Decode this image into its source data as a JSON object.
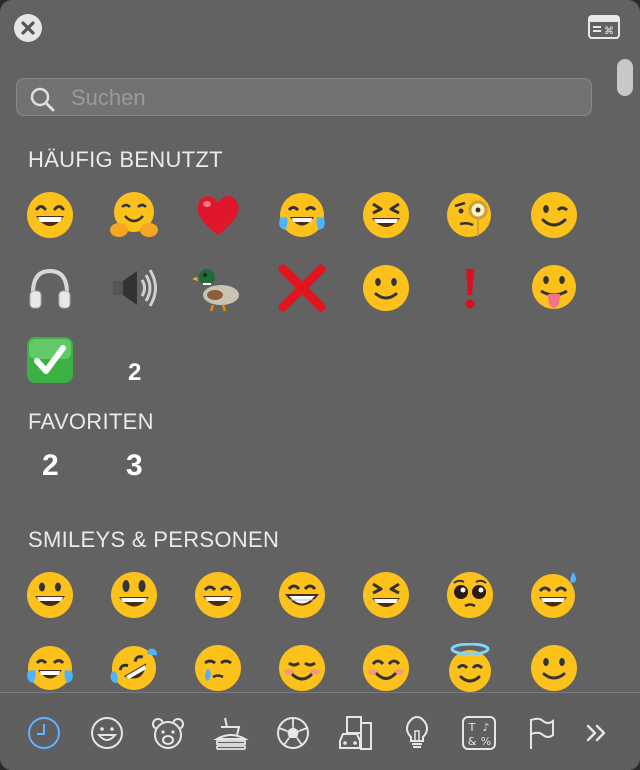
{
  "header": {
    "close_icon": "close-icon",
    "keyboard_viewer_icon": "keyboard-viewer-icon"
  },
  "search": {
    "placeholder": "Suchen",
    "value": "",
    "icon": "search-icon"
  },
  "sections": {
    "frequent": {
      "title": "HÄUFIG BENUTZT",
      "items": [
        "grinning-squinting-face",
        "hugging-face",
        "red-heart",
        "face-with-tears-of-joy",
        "grinning-squinting-eyes-face",
        "face-with-monocle",
        "winking-face",
        "headphones",
        "speaker-high-volume",
        "duck",
        "cross-mark",
        "slightly-smiling-face",
        "exclamation-mark",
        "face-with-tongue",
        "check-mark-button"
      ],
      "extra_number": "2"
    },
    "favorites": {
      "title": "FAVORITEN",
      "numbers": [
        "2",
        "3"
      ]
    },
    "smileys": {
      "title": "SMILEYS & PERSONEN",
      "items": [
        "grinning-face",
        "grinning-face-big-eyes",
        "grinning-face-smiling-eyes",
        "beaming-face",
        "grinning-squinting-face",
        "pleading-face",
        "grinning-face-with-sweat",
        "face-with-tears-of-joy",
        "rolling-on-floor-laughing",
        "face-holding-back-tears",
        "smiling-face",
        "smiling-face-with-smiling-eyes",
        "smiling-face-with-halo",
        "slightly-smiling-face"
      ]
    }
  },
  "categories": [
    {
      "name": "recent",
      "icon": "clock-icon",
      "selected": true
    },
    {
      "name": "smileys",
      "icon": "smiley-icon"
    },
    {
      "name": "animals",
      "icon": "bear-icon"
    },
    {
      "name": "food",
      "icon": "burger-drink-icon"
    },
    {
      "name": "activity",
      "icon": "soccer-ball-icon"
    },
    {
      "name": "travel",
      "icon": "car-building-icon"
    },
    {
      "name": "objects",
      "icon": "lightbulb-icon"
    },
    {
      "name": "symbols",
      "icon": "symbols-icon"
    },
    {
      "name": "flags",
      "icon": "flag-icon"
    },
    {
      "name": "more",
      "icon": "chevron-double-right-icon"
    }
  ],
  "colors": {
    "panel": "#626262",
    "accent": "#5fb2ff",
    "emoji_yellow": "#fcc21b"
  }
}
